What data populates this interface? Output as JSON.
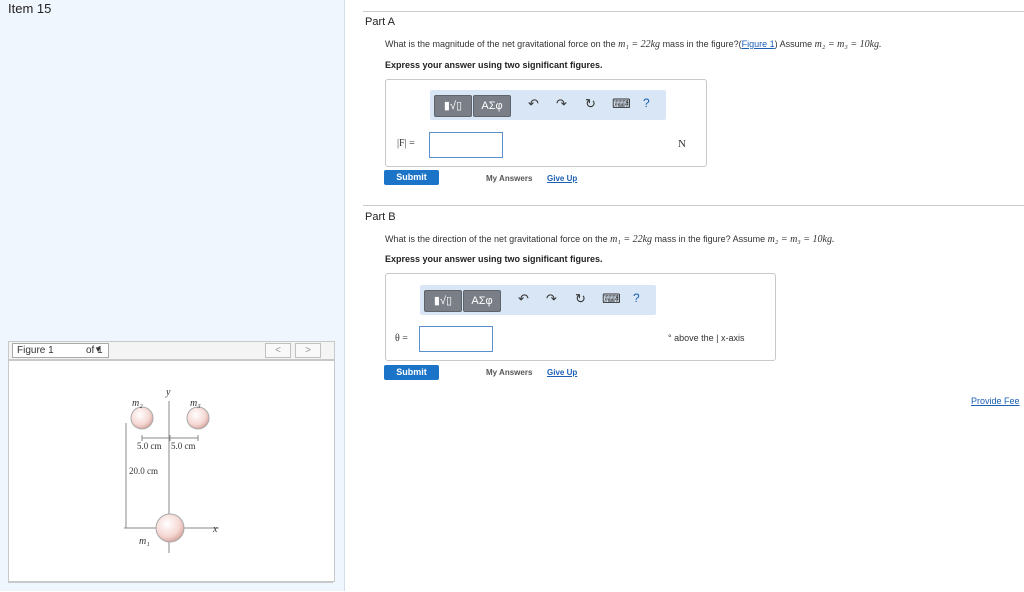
{
  "item": {
    "title": "Item 15"
  },
  "figure": {
    "selector_label": "Figure 1",
    "selector_of": "of 1",
    "prev": "<",
    "next": ">",
    "labels": {
      "m2": "m₂",
      "m3": "m₃",
      "m1": "m₁",
      "y": "y",
      "x": "x",
      "d1": "5.0 cm",
      "d2": "5.0 cm",
      "d3": "20.0 cm"
    }
  },
  "partA": {
    "title": "Part A",
    "q_pre": "What is the magnitude of the net gravitational force on the",
    "q_m1": "m₁ = 22kg",
    "q_mid": "mass in the figure?(",
    "q_link": "Figure 1",
    "q_post": ") Assume",
    "q_assume": "m₂ = m₃ = 10kg.",
    "instruction": "Express your answer using two significant figures.",
    "input_label": "|F| =",
    "unit": "N",
    "submit": "Submit",
    "my_answers": "My Answers",
    "give_up": "Give Up"
  },
  "partB": {
    "title": "Part B",
    "q_pre": "What is the direction of the net gravitational force on the",
    "q_m1": "m₁ = 22kg",
    "q_mid": "mass in the figure? Assume",
    "q_assume": "m₂ = m₃ = 10kg.",
    "instruction": "Express your answer using two significant figures.",
    "input_label": "θ =",
    "unit": "° above the  | x-axis",
    "submit": "Submit",
    "my_answers": "My Answers",
    "give_up": "Give Up"
  },
  "toolbar": {
    "templates": "▮√▯",
    "symbols": "ΑΣφ",
    "undo": "↶",
    "redo": "↷",
    "reset": "↻",
    "keyboard": "⌨",
    "help": "?"
  },
  "provide_feedback": "Provide Fee"
}
